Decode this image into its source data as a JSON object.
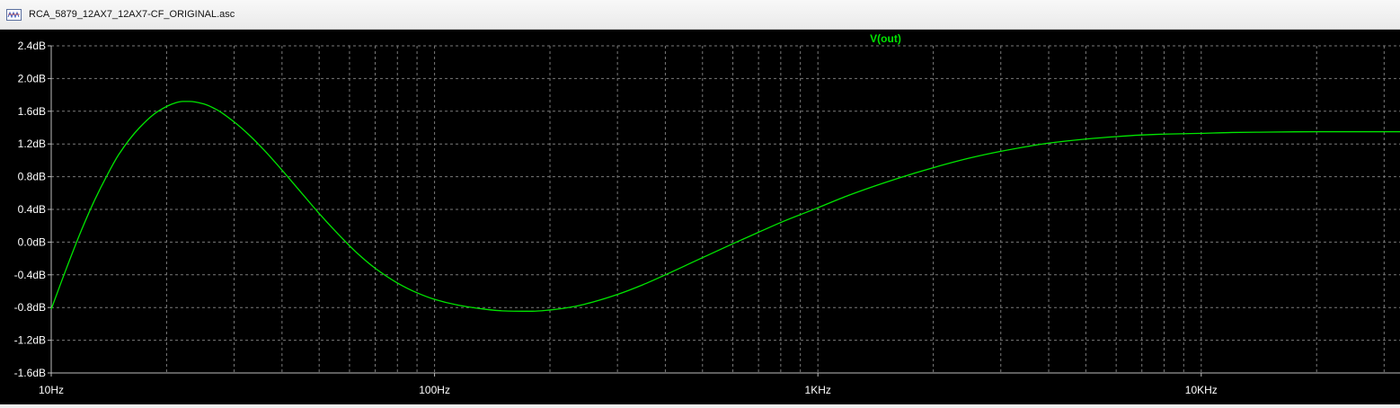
{
  "window": {
    "title": "RCA_5879_12AX7_12AX7-CF_ORIGINAL.asc",
    "icon": "ltspice-schematic-icon"
  },
  "plot": {
    "background": "#000000",
    "grid_color": "#7a7a7a",
    "axis_color": "#bdbdbd",
    "label_color": "#ffffff",
    "trace_color": "#00e600"
  },
  "chart_data": {
    "type": "line",
    "title": "V(out)",
    "xlabel": "",
    "ylabel": "",
    "x_scale": "log",
    "xlim": [
      10,
      33000
    ],
    "ylim": [
      -1.6,
      2.4
    ],
    "x_ticks": [
      {
        "value": 10,
        "label": "10Hz"
      },
      {
        "value": 100,
        "label": "100Hz"
      },
      {
        "value": 1000,
        "label": "1KHz"
      },
      {
        "value": 10000,
        "label": "10KHz"
      }
    ],
    "y_ticks": [
      {
        "value": 2.4,
        "label": "2.4dB"
      },
      {
        "value": 2.0,
        "label": "2.0dB"
      },
      {
        "value": 1.6,
        "label": "1.6dB"
      },
      {
        "value": 1.2,
        "label": "1.2dB"
      },
      {
        "value": 0.8,
        "label": "0.8dB"
      },
      {
        "value": 0.4,
        "label": "0.4dB"
      },
      {
        "value": 0.0,
        "label": "0.0dB"
      },
      {
        "value": -0.4,
        "label": "-0.4dB"
      },
      {
        "value": -0.8,
        "label": "-0.8dB"
      },
      {
        "value": -1.2,
        "label": "-1.2dB"
      },
      {
        "value": -1.6,
        "label": "-1.6dB"
      }
    ],
    "grid": true,
    "series": [
      {
        "name": "V(out)",
        "x": [
          10,
          11,
          12,
          13,
          14,
          15,
          17,
          19,
          21,
          22,
          23,
          25,
          27,
          30,
          33,
          36,
          40,
          45,
          50,
          56,
          63,
          70,
          80,
          90,
          100,
          115,
          130,
          150,
          170,
          180,
          200,
          230,
          260,
          300,
          350,
          400,
          500,
          600,
          700,
          800,
          1000,
          1200,
          1500,
          2000,
          2500,
          3000,
          4000,
          5000,
          6000,
          7000,
          8000,
          10000,
          12000,
          15000,
          20000,
          25000,
          33000
        ],
        "y": [
          -0.82,
          -0.3,
          0.15,
          0.52,
          0.82,
          1.07,
          1.4,
          1.6,
          1.7,
          1.72,
          1.72,
          1.69,
          1.62,
          1.47,
          1.3,
          1.12,
          0.88,
          0.6,
          0.35,
          0.1,
          -0.14,
          -0.32,
          -0.5,
          -0.62,
          -0.7,
          -0.77,
          -0.81,
          -0.84,
          -0.845,
          -0.845,
          -0.83,
          -0.79,
          -0.73,
          -0.64,
          -0.52,
          -0.4,
          -0.19,
          -0.02,
          0.12,
          0.24,
          0.42,
          0.57,
          0.73,
          0.91,
          1.03,
          1.11,
          1.21,
          1.26,
          1.29,
          1.31,
          1.32,
          1.33,
          1.34,
          1.345,
          1.35,
          1.35,
          1.35
        ]
      }
    ]
  }
}
